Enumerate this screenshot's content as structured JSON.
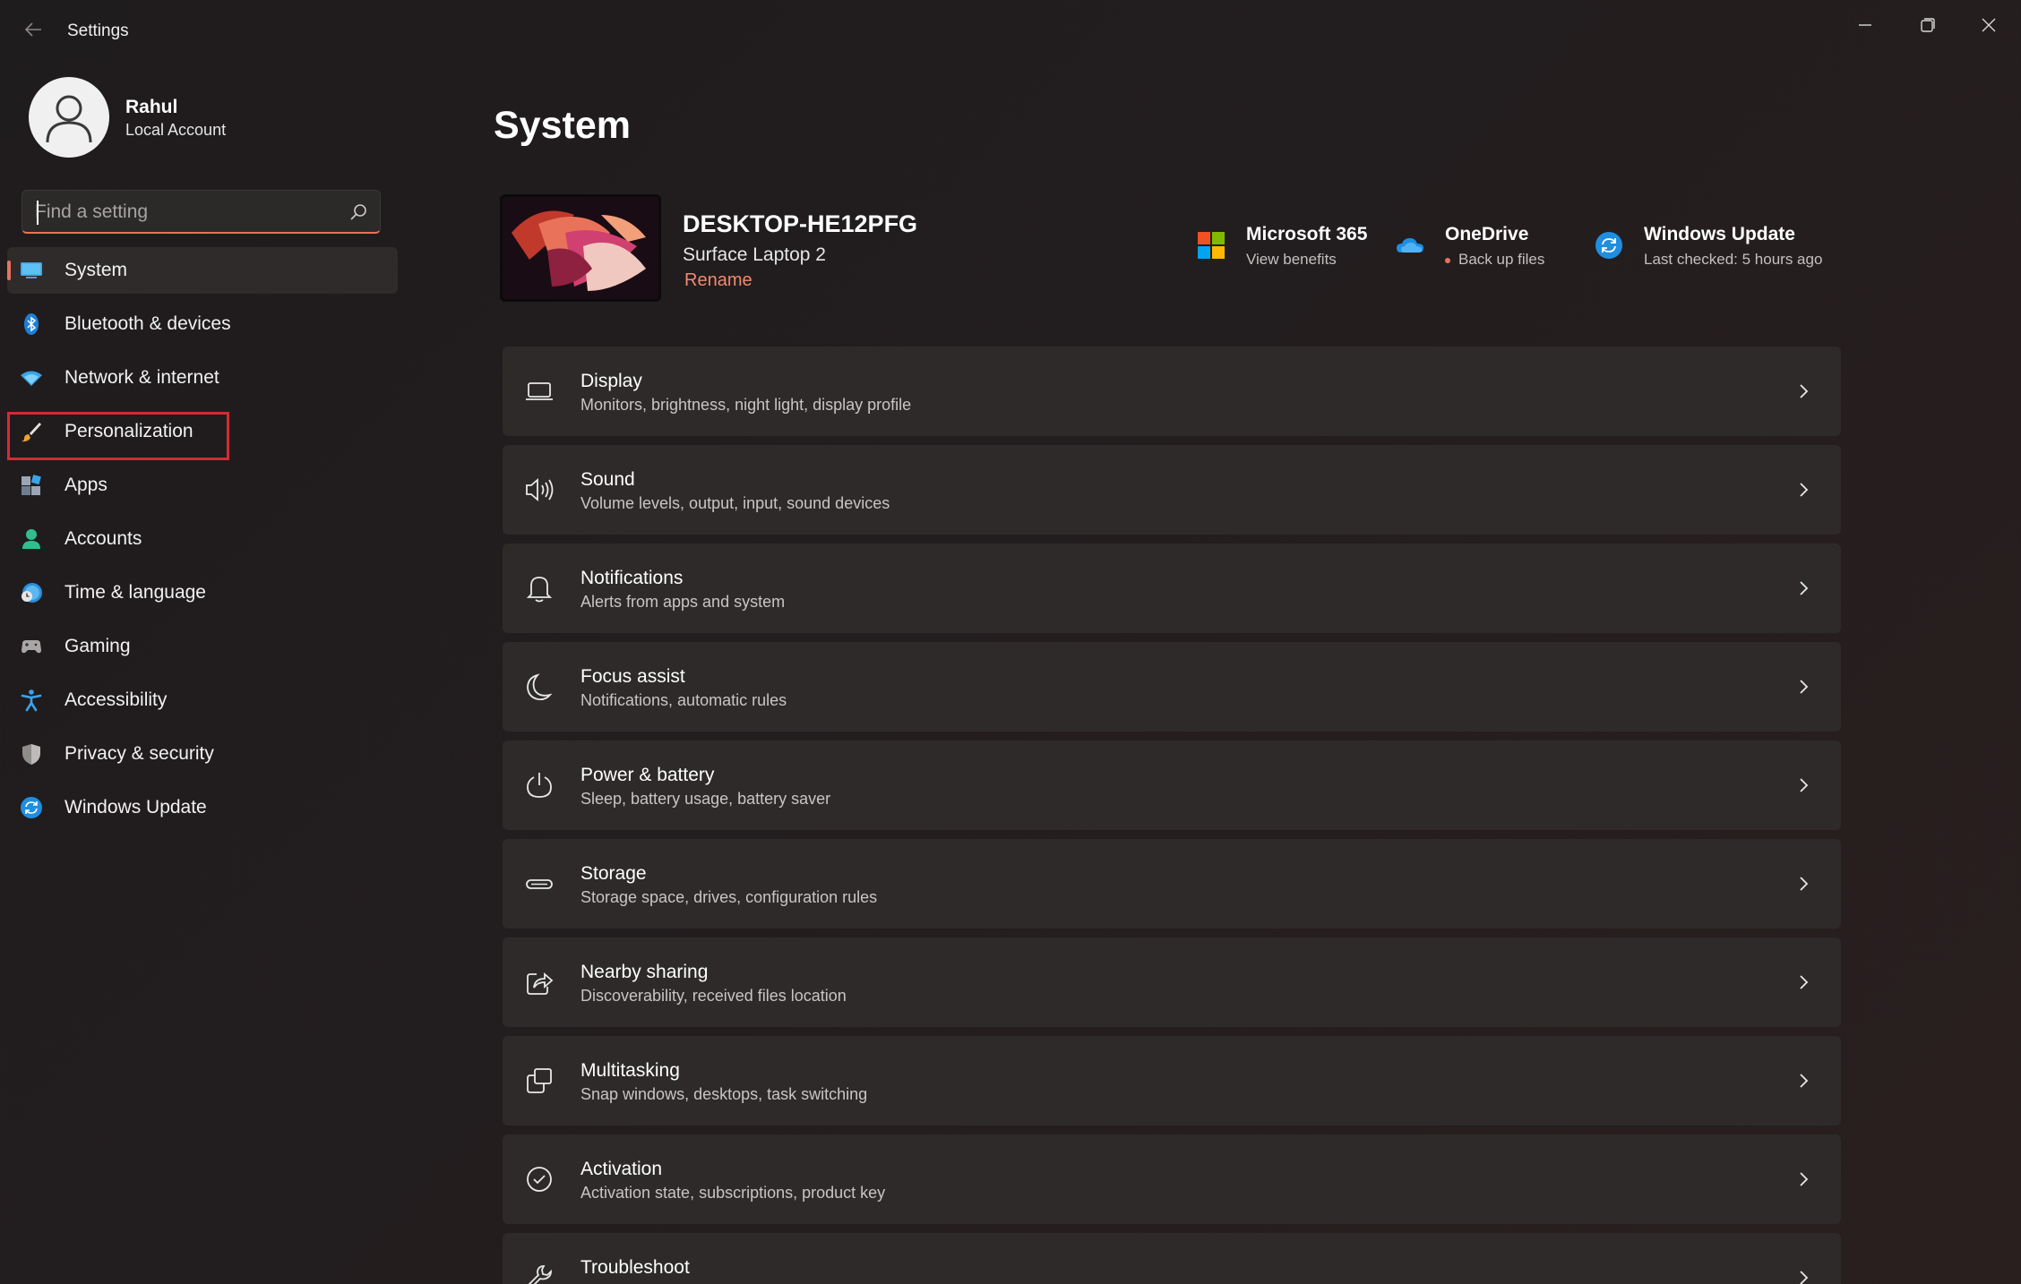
{
  "app": {
    "title": "Settings"
  },
  "user": {
    "name": "Rahul",
    "account_type": "Local Account"
  },
  "search": {
    "placeholder": "Find a setting"
  },
  "sidebar": {
    "items": [
      {
        "label": "System",
        "icon": "monitor-icon",
        "active": true
      },
      {
        "label": "Bluetooth & devices",
        "icon": "bluetooth-icon"
      },
      {
        "label": "Network & internet",
        "icon": "wifi-icon"
      },
      {
        "label": "Personalization",
        "icon": "brush-icon",
        "highlighted": true
      },
      {
        "label": "Apps",
        "icon": "apps-icon"
      },
      {
        "label": "Accounts",
        "icon": "person-icon"
      },
      {
        "label": "Time & language",
        "icon": "globe-clock-icon"
      },
      {
        "label": "Gaming",
        "icon": "gamepad-icon"
      },
      {
        "label": "Accessibility",
        "icon": "accessibility-icon"
      },
      {
        "label": "Privacy & security",
        "icon": "shield-icon"
      },
      {
        "label": "Windows Update",
        "icon": "update-icon"
      }
    ]
  },
  "main": {
    "title": "System",
    "device": {
      "name": "DESKTOP-HE12PFG",
      "model": "Surface Laptop 2",
      "rename_label": "Rename"
    },
    "quick_links": [
      {
        "title": "Microsoft 365",
        "subtitle": "View benefits",
        "icon": "microsoft-logo-icon"
      },
      {
        "title": "OneDrive",
        "subtitle": "Back up files",
        "icon": "cloud-icon"
      },
      {
        "title": "Windows Update",
        "subtitle": "Last checked: 5 hours ago",
        "icon": "update-icon"
      }
    ],
    "cards": [
      {
        "title": "Display",
        "subtitle": "Monitors, brightness, night light, display profile",
        "icon": "display-icon"
      },
      {
        "title": "Sound",
        "subtitle": "Volume levels, output, input, sound devices",
        "icon": "speaker-icon"
      },
      {
        "title": "Notifications",
        "subtitle": "Alerts from apps and system",
        "icon": "bell-icon"
      },
      {
        "title": "Focus assist",
        "subtitle": "Notifications, automatic rules",
        "icon": "moon-icon"
      },
      {
        "title": "Power & battery",
        "subtitle": "Sleep, battery usage, battery saver",
        "icon": "power-icon"
      },
      {
        "title": "Storage",
        "subtitle": "Storage space, drives, configuration rules",
        "icon": "storage-icon"
      },
      {
        "title": "Nearby sharing",
        "subtitle": "Discoverability, received files location",
        "icon": "share-icon"
      },
      {
        "title": "Multitasking",
        "subtitle": "Snap windows, desktops, task switching",
        "icon": "multitask-icon"
      },
      {
        "title": "Activation",
        "subtitle": "Activation state, subscriptions, product key",
        "icon": "check-circle-icon"
      },
      {
        "title": "Troubleshoot",
        "subtitle": "",
        "icon": "wrench-icon"
      }
    ]
  },
  "colors": {
    "accent": "#e8735a",
    "highlight": "#d42b33",
    "card_bg": "#2e2a2a"
  }
}
